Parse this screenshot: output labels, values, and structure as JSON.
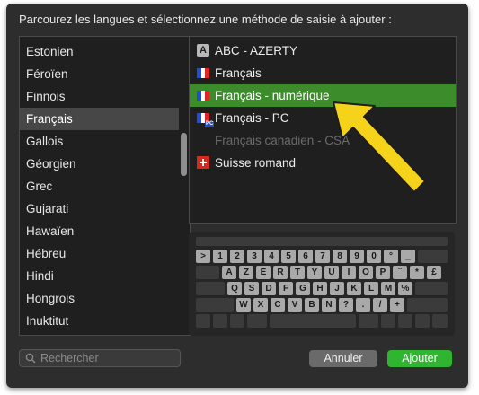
{
  "prompt": "Parcourez les langues et sélectionnez une méthode de saisie à ajouter :",
  "languages": [
    {
      "label": "Estonien"
    },
    {
      "label": "Féroïen"
    },
    {
      "label": "Finnois"
    },
    {
      "label": "Français",
      "selected": true
    },
    {
      "label": "Gallois"
    },
    {
      "label": "Géorgien"
    },
    {
      "label": "Grec"
    },
    {
      "label": "Gujarati"
    },
    {
      "label": "Hawaïen"
    },
    {
      "label": "Hébreu"
    },
    {
      "label": "Hindi"
    },
    {
      "label": "Hongrois"
    },
    {
      "label": "Inuktitut"
    }
  ],
  "methods": [
    {
      "label": "ABC - AZERTY",
      "icon": "abc-icon"
    },
    {
      "label": "Français",
      "icon": "flag-france-icon"
    },
    {
      "label": "Français - numérique",
      "icon": "flag-france-icon",
      "selected": true
    },
    {
      "label": "Français - PC",
      "icon": "flag-france-pc-icon"
    },
    {
      "label": "Français canadien - CSA",
      "icon": "flag-canada-icon",
      "disabled": true
    },
    {
      "label": "Suisse romand",
      "icon": "flag-switzerland-icon"
    }
  ],
  "abc_letter": "A",
  "pc_badge": "PC",
  "keyboard": {
    "row1": [
      ">",
      "1",
      "2",
      "3",
      "4",
      "5",
      "6",
      "7",
      "8",
      "9",
      "0",
      "°",
      "_"
    ],
    "row2": [
      "A",
      "Z",
      "E",
      "R",
      "T",
      "Y",
      "U",
      "I",
      "O",
      "P",
      "¨",
      "*",
      "£"
    ],
    "row3": [
      "Q",
      "S",
      "D",
      "F",
      "G",
      "H",
      "J",
      "K",
      "L",
      "M",
      "%"
    ],
    "row4": [
      "W",
      "X",
      "C",
      "V",
      "B",
      "N",
      "?",
      ".",
      "/",
      "+"
    ]
  },
  "search": {
    "placeholder": "Rechercher"
  },
  "buttons": {
    "cancel": "Annuler",
    "add": "Ajouter"
  },
  "colors": {
    "selection": "#3d8c2c",
    "add_button": "#2fb52f",
    "arrow": "#f6d31b"
  }
}
